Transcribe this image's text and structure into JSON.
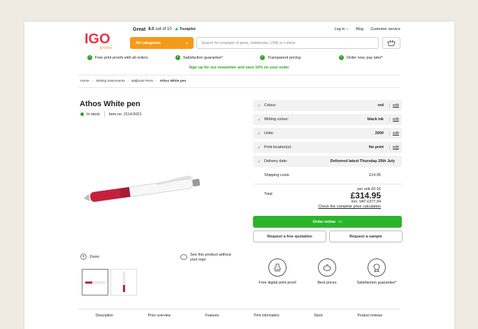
{
  "header": {
    "logo_text": "IGO",
    "logo_sub": "promo",
    "rating_label": "Great",
    "rating_score": "8.0",
    "rating_out_of": "out of 10",
    "trustpilot": "Trustpilot",
    "links": [
      "Log in",
      "Blog",
      "Customer service"
    ],
    "categories_label": "All categories",
    "search_placeholder": "Search for example of pens, notebooks, USB or t-shirts"
  },
  "usps": [
    "Free print proofs with all orders",
    "Satisfaction guarantee*",
    "Transparent pricing",
    "Order now, pay later*"
  ],
  "newsletter": "Sign up for our newsletter and save 10% on your order.",
  "breadcrumb": [
    "Home",
    "Writing Instruments",
    "Ballpoint Pens",
    "Athos White pen"
  ],
  "product": {
    "title": "Athos White pen",
    "stock": "In stock",
    "item_no": "item.no. 2114.6021",
    "zoom": "Zoom",
    "see_without_logo": "See this product without your logo"
  },
  "options": [
    {
      "label": "Colour:",
      "value": "red",
      "edit": "edit"
    },
    {
      "label": "Writing colour:",
      "value": "black ink",
      "edit": "edit"
    },
    {
      "label": "Units:",
      "value": "2000",
      "edit": "edit"
    },
    {
      "label": "Print location(s):",
      "value": "No print",
      "edit": "edit"
    },
    {
      "label": "Delivery date:",
      "value": "Delivered latest Thursday 25th July"
    }
  ],
  "shipping": {
    "label": "Shipping costs",
    "value": "£14.95"
  },
  "total": {
    "label": "Total",
    "per_unit": "per unit £0.16",
    "price": "£314.95",
    "incl_vat": "incl. VAT  £377.94",
    "calc_link": "Check the complete price calculation"
  },
  "buttons": {
    "order": "Order online",
    "quotation": "Request a free quotation",
    "sample": "Request a sample"
  },
  "features": [
    "Free digital print proof",
    "Best prices",
    "Satisfaction guarantee*"
  ],
  "tabs": [
    "Description",
    "Price overview",
    "Features",
    "Print information",
    "Stock",
    "Product reviews"
  ],
  "colors": {
    "accent_orange": "#f59a18",
    "accent_green": "#2bb52b",
    "logo_red": "#e8334a"
  }
}
